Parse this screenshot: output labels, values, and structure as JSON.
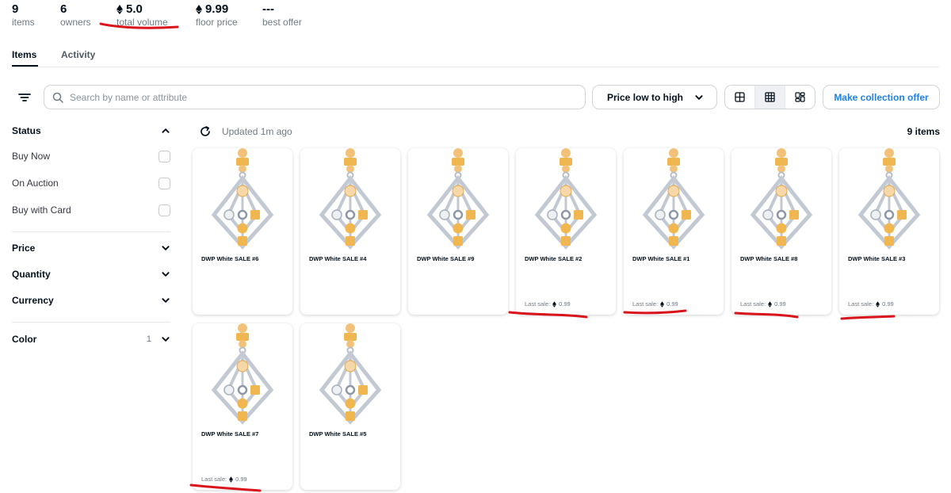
{
  "stats": [
    {
      "value": "9",
      "label": "items",
      "eth": false
    },
    {
      "value": "6",
      "label": "owners",
      "eth": false
    },
    {
      "value": "5.0",
      "label": "total volume",
      "eth": true
    },
    {
      "value": "9.99",
      "label": "floor price",
      "eth": true
    },
    {
      "value": "---",
      "label": "best offer",
      "eth": false
    }
  ],
  "tabs": {
    "items": "Items",
    "activity": "Activity"
  },
  "toolbar": {
    "search_placeholder": "Search by name or attribute",
    "sort_label": "Price low to high",
    "offer_label": "Make collection offer",
    "view_modes": [
      "large-grid",
      "grid",
      "masonry"
    ],
    "active_view": "grid"
  },
  "sidebar": {
    "status_title": "Status",
    "status_options": [
      "Buy Now",
      "On Auction",
      "Buy with Card"
    ],
    "price_title": "Price",
    "quantity_title": "Quantity",
    "currency_title": "Currency",
    "color_title": "Color",
    "color_count": "1"
  },
  "results": {
    "updated": "Updated 1m ago",
    "count": "9 items"
  },
  "cards": [
    {
      "name": "DWP White SALE #6",
      "last_sale_label": "",
      "last_sale": ""
    },
    {
      "name": "DWP White SALE #4",
      "last_sale_label": "",
      "last_sale": ""
    },
    {
      "name": "DWP White SALE #9",
      "last_sale_label": "",
      "last_sale": ""
    },
    {
      "name": "DWP White SALE #2",
      "last_sale_label": "Last sale:",
      "last_sale": "0.99"
    },
    {
      "name": "DWP White SALE #1",
      "last_sale_label": "Last sale:",
      "last_sale": "0.99"
    },
    {
      "name": "DWP White SALE #8",
      "last_sale_label": "Last sale:",
      "last_sale": "0.99"
    },
    {
      "name": "DWP White SALE #3",
      "last_sale_label": "Last sale:",
      "last_sale": "0.99"
    },
    {
      "name": "DWP White SALE #7",
      "last_sale_label": "Last sale:",
      "last_sale": "0.99"
    },
    {
      "name": "DWP White SALE #5",
      "last_sale_label": "",
      "last_sale": ""
    }
  ],
  "colors": {
    "accent": "#2081e2",
    "text": "#04111d",
    "muted": "#707a83",
    "annotation": "#d9141b",
    "jewel_gold": "#f0b64f",
    "jewel_silver": "#b5bcc8"
  }
}
